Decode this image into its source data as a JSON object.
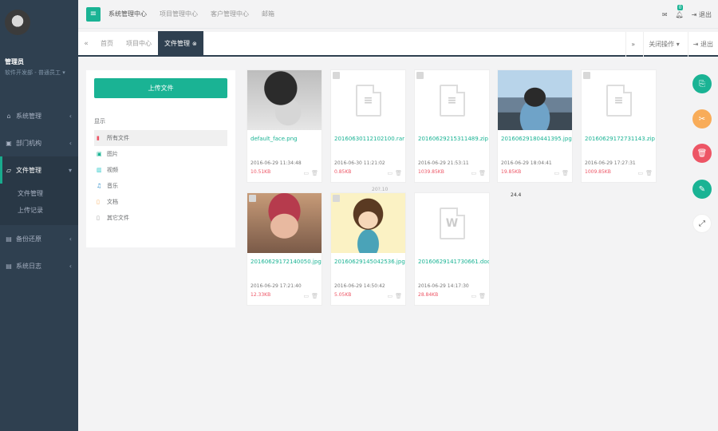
{
  "sidebar": {
    "profile": {
      "name": "管理员",
      "role": "软件开发部 - 普通员工 ▾"
    },
    "items": [
      {
        "icon": "home-icon",
        "label": "系统管理",
        "arrow": "‹"
      },
      {
        "icon": "org-icon",
        "label": "部门机构",
        "arrow": "‹"
      },
      {
        "icon": "file-icon",
        "label": "文件管理",
        "arrow": "▾",
        "active": true
      },
      {
        "icon": "backup-icon",
        "label": "备份还原",
        "arrow": "‹"
      },
      {
        "icon": "log-icon",
        "label": "系统日志",
        "arrow": "‹"
      }
    ],
    "subitems": [
      "文件管理",
      "上传记录"
    ]
  },
  "topbar": {
    "tabs": [
      "系统管理中心",
      "项目管理中心",
      "客户管理中心",
      "邮箱"
    ],
    "notif_count": "0",
    "logout": "退出"
  },
  "tabbar": {
    "tabs": [
      {
        "label": "首页"
      },
      {
        "label": "项目中心"
      },
      {
        "label": "文件管理",
        "active": true
      }
    ],
    "close_ops": "关闭操作 ▾",
    "exit": "退出"
  },
  "panel": {
    "upload_label": "上传文件",
    "dir_title": "显示",
    "dirs": [
      {
        "icon": "all-files-icon",
        "label": "所有文件",
        "color": "#ed5565"
      },
      {
        "icon": "image-icon",
        "label": "图片",
        "color": "#1ab394"
      },
      {
        "icon": "video-icon",
        "label": "视频",
        "color": "#23c6c8"
      },
      {
        "icon": "music-icon",
        "label": "音乐",
        "color": "#1c84c6"
      },
      {
        "icon": "doc-icon",
        "label": "文档",
        "color": "#f8ac59"
      },
      {
        "icon": "other-icon",
        "label": "其它文件",
        "color": "#999"
      }
    ]
  },
  "files": [
    {
      "name": "default_face.png",
      "date": "2016-06-29 11:34:48",
      "size": "10.51KB",
      "thumb": "photo-dark"
    },
    {
      "name": "20160630112102100.rar",
      "date": "2016-06-30 11:21:02",
      "size": "0.85KB",
      "thumb": "zip"
    },
    {
      "name": "20160629215311489.zip",
      "date": "2016-06-29 21:53:11",
      "size": "1039.85KB",
      "thumb": "zip"
    },
    {
      "name": "20160629180441395.jpg",
      "date": "2016-06-29 18:04:41",
      "size": "19.85KB",
      "thumb": "photo-sea"
    },
    {
      "name": "20160629172731143.zip",
      "date": "2016-06-29 17:27:31",
      "size": "1009.85KB",
      "thumb": "zip"
    },
    {
      "name": "20160629172140050.jpg",
      "date": "2016-06-29 17:21:40",
      "size": "12.33KB",
      "thumb": "photo-warm"
    },
    {
      "name": "20160629145042536.jpg",
      "date": "2016-06-29 14:50:42",
      "size": "5.05KB",
      "thumb": "photo-cartoon"
    },
    {
      "name": "20160629141730661.docx",
      "date": "2016-06-29 14:17:30",
      "size": "28.84KB",
      "thumb": "word"
    }
  ],
  "stray_labels": [
    "24.4",
    "20?.10"
  ],
  "colors": {
    "accent": "#1ab394",
    "sidebar": "#2f4050",
    "danger": "#ed5565",
    "warning": "#f8ac59"
  }
}
